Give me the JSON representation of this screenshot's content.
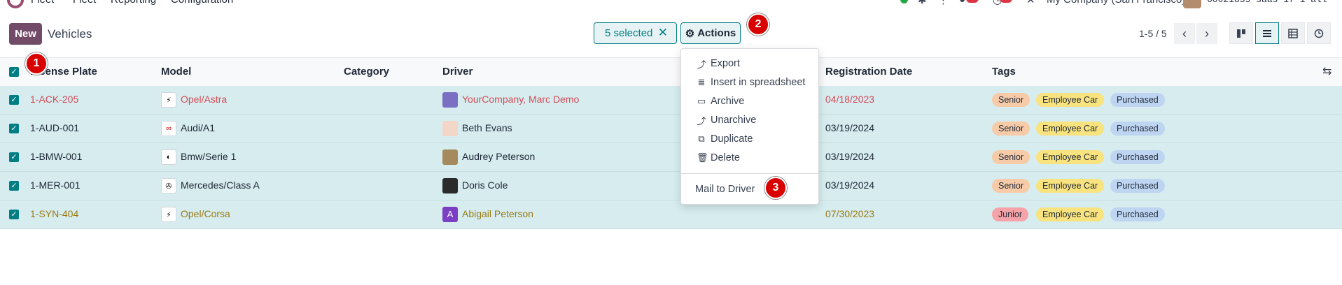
{
  "topnav": {
    "app_name": "Fleet",
    "menu": [
      "Fleet",
      "Reporting",
      "Configuration"
    ],
    "company": "My Company (San Francisco)",
    "database": "60021859-saas-17-1-all"
  },
  "control_panel": {
    "new_label": "New",
    "title": "Vehicles",
    "selected_label": "5 selected",
    "clear_icon": "✕",
    "actions_label": "Actions",
    "pager": "1-5 / 5",
    "views": [
      "kanban-icon",
      "list-icon",
      "pivot-icon",
      "activity-icon"
    ]
  },
  "table": {
    "columns": [
      "License Plate",
      "Model",
      "Category",
      "Driver",
      "Registration Date",
      "Tags"
    ],
    "rows": [
      {
        "plate": "1-ACK-205",
        "logo": "opel",
        "model": "Opel/Astra",
        "driver": "YourCompany, Marc Demo",
        "reg_date": "04/18/2023",
        "tags": [
          "Senior",
          "Employee Car",
          "Purchased"
        ],
        "tone": "red"
      },
      {
        "plate": "1-AUD-001",
        "logo": "audi",
        "model": "Audi/A1",
        "driver": "Beth Evans",
        "reg_date": "03/19/2024",
        "tags": [
          "Senior",
          "Employee Car",
          "Purchased"
        ],
        "tone": "dark"
      },
      {
        "plate": "1-BMW-001",
        "logo": "bmw",
        "model": "Bmw/Serie 1",
        "driver": "Audrey Peterson",
        "reg_date": "03/19/2024",
        "tags": [
          "Senior",
          "Employee Car",
          "Purchased"
        ],
        "tone": "dark"
      },
      {
        "plate": "1-MER-001",
        "logo": "mercedes",
        "model": "Mercedes/Class A",
        "driver": "Doris Cole",
        "reg_date": "03/19/2024",
        "tags": [
          "Senior",
          "Employee Car",
          "Purchased"
        ],
        "tone": "dark"
      },
      {
        "plate": "1-SYN-404",
        "logo": "opel",
        "model": "Opel/Corsa",
        "driver": "Abigail Peterson",
        "reg_date": "07/30/2023",
        "tags": [
          "Junior",
          "Employee Car",
          "Purchased"
        ],
        "tone": "olive",
        "driver_initial": "A"
      }
    ]
  },
  "actions_menu": {
    "items": [
      {
        "icon": "export-icon",
        "glyph": "⤴",
        "label": "Export"
      },
      {
        "icon": "spreadsheet-icon",
        "glyph": "≣",
        "label": "Insert in spreadsheet"
      },
      {
        "icon": "archive-icon",
        "glyph": "▭",
        "label": "Archive"
      },
      {
        "icon": "unarchive-icon",
        "glyph": "⤴",
        "label": "Unarchive"
      },
      {
        "icon": "duplicate-icon",
        "glyph": "⧉",
        "label": "Duplicate"
      },
      {
        "icon": "trash-icon",
        "glyph": "🗑",
        "label": "Delete"
      }
    ],
    "extra": "Mail to Driver"
  },
  "markers": [
    "1",
    "2",
    "3"
  ],
  "colors": {
    "primary": "#714b67",
    "accent": "#017e84",
    "row_selected": "#d6ecee",
    "marker": "#d90000"
  }
}
